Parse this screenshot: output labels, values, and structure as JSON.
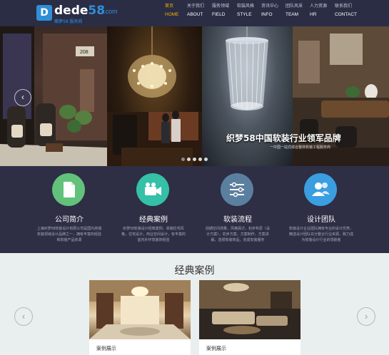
{
  "logo": {
    "mark": "D",
    "name_a": "dede",
    "name_b": "58",
    "domain": ".com",
    "tagline": "織夢58 服务商"
  },
  "nav": [
    {
      "cn": "首页",
      "en": "HOME",
      "active": true
    },
    {
      "cn": "关于我们",
      "en": "ABOUT",
      "active": false
    },
    {
      "cn": "服务领域",
      "en": "FIELD",
      "active": false
    },
    {
      "cn": "软装风格",
      "en": "STYLE",
      "active": false
    },
    {
      "cn": "资讯中心",
      "en": "INFO",
      "active": false
    },
    {
      "cn": "团队风采",
      "en": "TEAM",
      "active": false
    },
    {
      "cn": "人力资源",
      "en": "HR",
      "active": false
    },
    {
      "cn": "联系我们",
      "en": "CONTACT",
      "active": false
    }
  ],
  "banner": {
    "title": "织梦58中国软装行业领军品牌",
    "subtitle": "一中国一站式综合整体软装工程服务商",
    "prev_icon": "chevron-left-icon",
    "slide_count": 5,
    "active_slide": 1
  },
  "services": [
    {
      "title": "公司简介",
      "desc": "上海织梦58软装设计有限公司是国内高端软装领域设计品牌之一，拥有丰富的经验和软装产品资源",
      "icon": "document-icon",
      "color": "#62c17a"
    },
    {
      "title": "经典案例",
      "desc": "织梦58软装设计经典案例，高端住宅风格，住宅设计，商业空间设计，有丰富的室内外环境装饰经验",
      "icon": "video-camera-icon",
      "color": "#35c0a8"
    },
    {
      "title": "软装流程",
      "desc": "前期空间测量，风格探讨，初步构思（设计方案），初步方案，方案制作，方案讲解，选择软装饰品，完成安装服务",
      "icon": "sliders-icon",
      "color": "#5b7f9f"
    },
    {
      "title": "设计团队",
      "desc": "软装设计企业团队拥有专业的设计优势，精选设计团队充分整合行业资源，致力成为软装设计行业的领航者",
      "icon": "users-icon",
      "color": "#3a9ee0"
    }
  ],
  "cases": {
    "title": "经典案例",
    "items": [
      {
        "label": "案例展示"
      },
      {
        "label": "案例展示"
      }
    ],
    "prev_icon": "chevron-left-icon",
    "next_icon": "chevron-right-icon"
  }
}
